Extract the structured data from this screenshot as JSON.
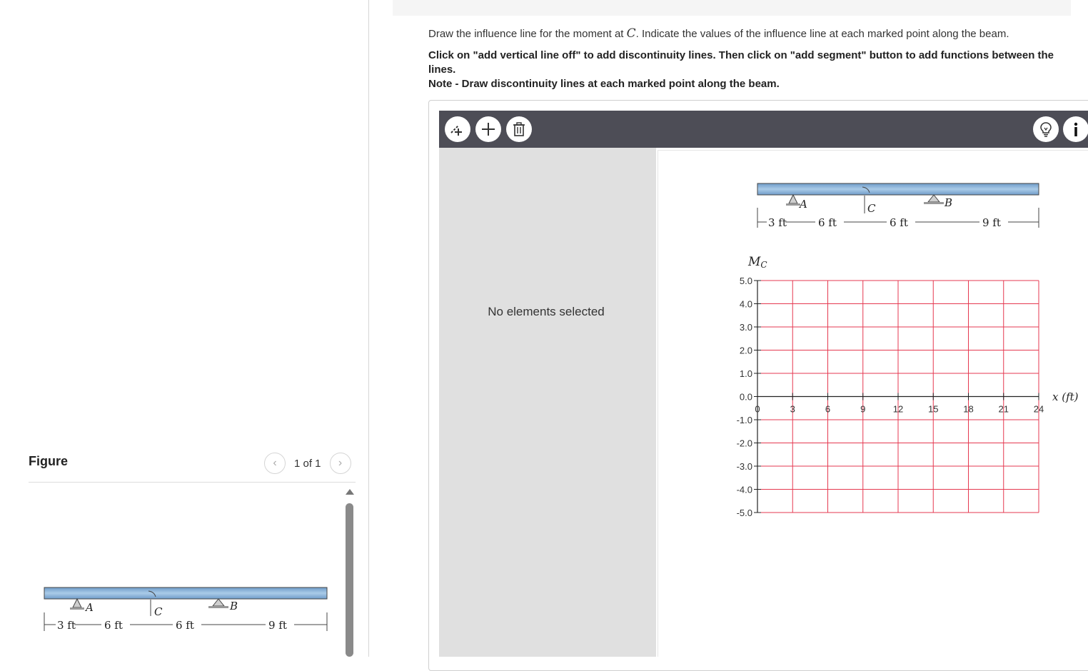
{
  "question": {
    "line1_pre": "Draw the influence line for the moment at ",
    "line1_var": "C",
    "line1_post": ". Indicate the values of the influence line at each marked point along the beam.",
    "line2": "Click on \"add vertical line off\" to add discontinuity lines. Then click on \"add segment\" button to add functions between the lines.",
    "line3": "Note - Draw discontinuity lines at each marked point along the beam."
  },
  "figure": {
    "title": "Figure",
    "pager": "1 of 1",
    "prev_icon": "chevron-left-icon",
    "next_icon": "chevron-right-icon"
  },
  "beam": {
    "support_a": "A",
    "support_b": "B",
    "point_c": "C",
    "dims": [
      "3 ft",
      "6 ft",
      "6 ft",
      "9 ft"
    ],
    "beam_color": "#8fb8dc"
  },
  "toolbar": {
    "left_icons": [
      "add-vertical-line-icon",
      "add-segment-icon",
      "delete-icon"
    ],
    "right_icons": [
      "hint-lightbulb-icon",
      "info-icon"
    ]
  },
  "sidebar": {
    "status": "No elements selected"
  },
  "chart_data": {
    "type": "line",
    "ylabel": "M_C",
    "xlabel": "x (ft)",
    "xlim": [
      0,
      24
    ],
    "ylim": [
      -5,
      5
    ],
    "x_ticks": [
      "0",
      "3",
      "6",
      "9",
      "12",
      "15",
      "18",
      "21",
      "24"
    ],
    "y_ticks": [
      "5.0",
      "4.0",
      "3.0",
      "2.0",
      "1.0",
      "0.0",
      "-1.0",
      "-2.0",
      "-3.0",
      "-4.0",
      "-5.0"
    ],
    "grid": true,
    "grid_color": "#e53950",
    "series": []
  }
}
